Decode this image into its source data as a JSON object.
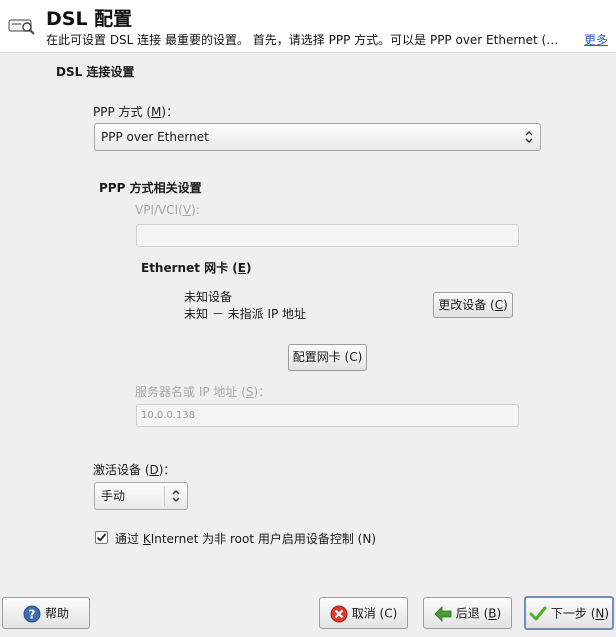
{
  "header": {
    "title": "DSL 配置",
    "subtitle": "在此可设置 DSL 连接 最重要的设置。 首先，请选择 PPP 方式。可以是 PPP over Ethernet (…",
    "more_link": "更多",
    "icon": "dsl-modem-icon"
  },
  "dsl_settings": {
    "section_title": "DSL 连接设置",
    "ppp_mode_label_pre": "PPP 方式 (",
    "ppp_mode_label_key": "M",
    "ppp_mode_label_post": ")：",
    "ppp_mode_value": "PPP over Ethernet"
  },
  "ppp_specific": {
    "section_title": "PPP 方式相关设置",
    "vpi_vci_label_pre": "VPI/VCI(",
    "vpi_vci_label_key": "V",
    "vpi_vci_label_post": "):",
    "vpi_vci_value": "",
    "ethernet_label_pre": "Ethernet 网卡 (",
    "ethernet_label_key": "E",
    "ethernet_label_post": ")",
    "device_name": "未知设备",
    "device_ip": "未知 － 未指派 IP 地址",
    "change_device_button_pre": "更改设备 (",
    "change_device_button_key": "C",
    "change_device_button_post": ")",
    "configure_nic_button": "配置网卡 (C)",
    "server_label_pre": "服务器名或 IP 地址 (",
    "server_label_key": "S",
    "server_label_post": ")：",
    "server_value": "10.0.0.138"
  },
  "activation": {
    "label_pre": "激活设备 (",
    "label_key": "D",
    "label_post": ")：",
    "value": "手动"
  },
  "kinternet": {
    "checked": true,
    "label_pre": "通过 ",
    "label_key": "K",
    "label_post": "Internet 为非 root 用户启用设备控制 (N)"
  },
  "footer": {
    "help_button": "帮助",
    "cancel_button": "取消 (C)",
    "back_button_pre": "后退 (",
    "back_button_key": "B",
    "back_button_post": ")",
    "next_button_pre": "下一步 (",
    "next_button_key": "N",
    "next_button_post": ")"
  },
  "colors": {
    "accent": "#6f8fb8",
    "link": "#2b5fbf",
    "cancel_red": "#d93a2b",
    "back_green": "#4a9a3a",
    "next_green": "#4caf2e"
  }
}
